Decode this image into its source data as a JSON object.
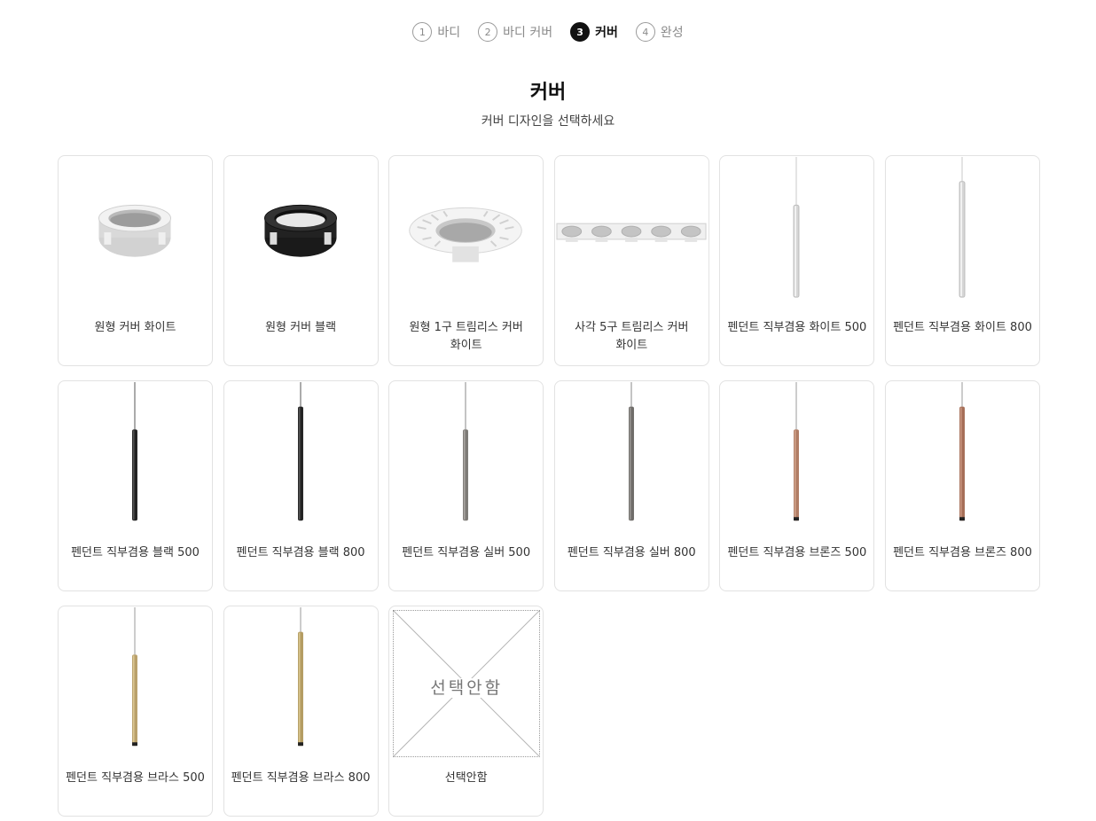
{
  "steps": [
    {
      "num": "1",
      "label": "바디"
    },
    {
      "num": "2",
      "label": "바디 커버"
    },
    {
      "num": "3",
      "label": "커버"
    },
    {
      "num": "4",
      "label": "완성"
    }
  ],
  "title": "커버",
  "subtitle": "커버 디자인을 선택하세요",
  "options": [
    {
      "label": "원형 커버 화이트",
      "icon": "round-cover-white-image",
      "color": "#e0e0e0"
    },
    {
      "label": "원형 커버 블랙",
      "icon": "round-cover-black-image",
      "color": "#1c1c1c"
    },
    {
      "label": "원형 1구 트림리스 커버 화이트",
      "icon": "trimless-1-cover-white-image",
      "color": "#e6e6e6"
    },
    {
      "label": "사각 5구 트림리스 커버 화이트",
      "icon": "trimless-5-cover-white-image",
      "color": "#e6e6e6"
    },
    {
      "label": "펜던트 직부겸용 화이트 500",
      "icon": "pendant-white-500-image",
      "color": "#d4d4d4"
    },
    {
      "label": "펜던트 직부겸용 화이트 800",
      "icon": "pendant-white-800-image",
      "color": "#d4d4d4"
    },
    {
      "label": "펜던트 직부겸용 블랙 500",
      "icon": "pendant-black-500-image",
      "color": "#222222"
    },
    {
      "label": "펜던트 직부겸용 블랙 800",
      "icon": "pendant-black-800-image",
      "color": "#222222"
    },
    {
      "label": "펜던트 직부겸용 실버 500",
      "icon": "pendant-silver-500-image",
      "color": "#7d7a76"
    },
    {
      "label": "펜던트 직부겸용 실버 800",
      "icon": "pendant-silver-800-image",
      "color": "#6f6c69"
    },
    {
      "label": "펜던트 직부겸용 브론즈 500",
      "icon": "pendant-bronze-500-image",
      "color": "#b07c64"
    },
    {
      "label": "펜던트 직부겸용 브론즈 800",
      "icon": "pendant-bronze-800-image",
      "color": "#a66f58"
    },
    {
      "label": "펜던트 직부겸용 브라스 500",
      "icon": "pendant-brass-500-image",
      "color": "#b9a06a"
    },
    {
      "label": "펜던트 직부겸용 브라스 800",
      "icon": "pendant-brass-800-image",
      "color": "#b49c62"
    },
    {
      "label": "선택안함",
      "icon": "no-selection-image",
      "placeholder_text": "선택안함"
    }
  ],
  "colors": {
    "active_step": "#111111",
    "inactive_step": "#8a8a8a",
    "card_border": "#e2e2e2"
  }
}
